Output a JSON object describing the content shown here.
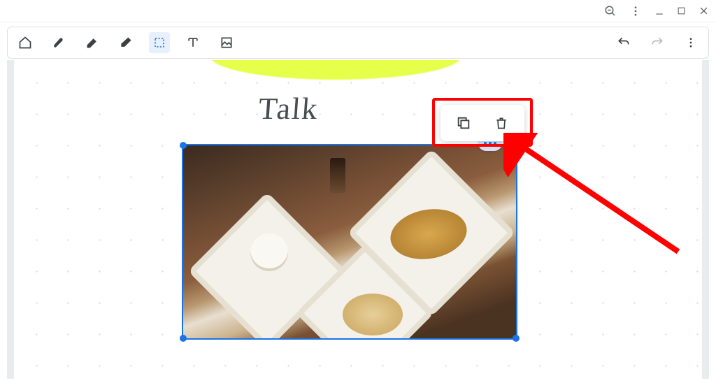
{
  "titlebar": {
    "zoom_icon": "zoom-out",
    "kebab_icon": "kebab",
    "minimize_icon": "minimize",
    "maximize_icon": "maximize",
    "close_icon": "close"
  },
  "toolbar": {
    "home_icon": "home",
    "pen_icon": "pen",
    "highlighter_icon": "highlighter",
    "eraser_icon": "eraser",
    "select_icon": "select",
    "select_active": true,
    "text_icon": "text",
    "image_icon": "image",
    "undo_icon": "undo",
    "redo_icon": "redo",
    "more_icon": "more-vert"
  },
  "canvas": {
    "handwriting_text": "Talk",
    "highlighter_color": "#e6ff4a",
    "selection": {
      "image_subject": "breakfast table with plates and coffee",
      "border_color": "#1a73e8",
      "more_icon": "more-horiz"
    },
    "context_popup": {
      "copy_icon": "copy",
      "delete_icon": "delete"
    }
  },
  "annotation": {
    "highlight_color": "#ff0000"
  }
}
